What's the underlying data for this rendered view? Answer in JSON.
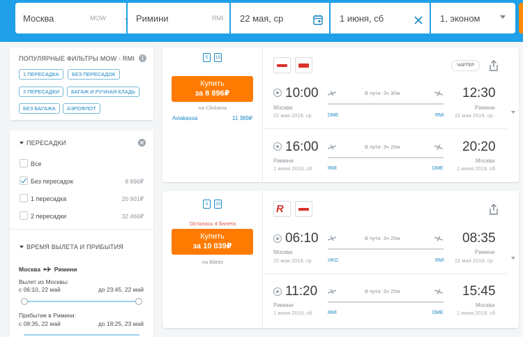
{
  "search": {
    "from": "Москва",
    "from_code": "MOW",
    "to": "Римини",
    "to_code": "RMI",
    "depart": "22 мая, ср",
    "return": "1 июня, сб",
    "passengers": "1, эконом"
  },
  "popular": {
    "title": "ПОПУЛЯРНЫЕ ФИЛЬТРЫ MOW - RMI",
    "chips": [
      "1 ПЕРЕСАДКА",
      "БЕЗ ПЕРЕСАДОК",
      "2 ПЕРЕСАДКИ",
      "БАГАЖ И РУЧНАЯ КЛАДЬ",
      "БЕЗ БАГАЖА",
      "АЭРОФЛОТ"
    ]
  },
  "stops": {
    "title": "ПЕРЕСАДКИ",
    "options": [
      {
        "label": "Все",
        "price": ""
      },
      {
        "label": "Без пересадок",
        "price": "8 896₽"
      },
      {
        "label": "1 пересадка",
        "price": "20 901₽"
      },
      {
        "label": "2 пересадки",
        "price": "32 466₽"
      }
    ]
  },
  "times": {
    "title": "ВРЕМЯ ВЫЛЕТА И ПРИБЫТИЯ",
    "route_from": "Москва",
    "route_to": "Римини",
    "departure_label": "Вылет из Москвы:",
    "departure_from": "с 06:10, 22 май",
    "departure_to": "до 23:45, 22 май",
    "arrival_label": "Прибытие в Римини:",
    "arrival_from": "с 08:35, 22 май",
    "arrival_to": "до 18:25, 23 май"
  },
  "results": [
    {
      "bag_a": "5",
      "bag_b": "15",
      "buy_label": "Купить",
      "price": "за 8 896₽",
      "seats_left": "",
      "agency": "на Clickavia",
      "alt_agency": "Aviakassa",
      "alt_price": "11 389₽",
      "badge": "ЧАРТЕР",
      "legs": [
        {
          "dep_time": "10:00",
          "arr_time": "12:30",
          "dep_city": "Москва",
          "arr_city": "Римини",
          "dep_date": "22 мая 2019, ср",
          "arr_date": "22 мая 2019, ср",
          "duration": "В пути: 3ч 30м",
          "dep_code": "DME",
          "arr_code": "RMI"
        },
        {
          "dep_time": "16:00",
          "arr_time": "20:20",
          "dep_city": "Римини",
          "arr_city": "Москва",
          "dep_date": "1 июня 2019, сб",
          "arr_date": "1 июня 2019, сб",
          "duration": "В пути: 3ч 20м",
          "dep_code": "RMI",
          "arr_code": "DME"
        }
      ]
    },
    {
      "bag_a": "5",
      "bag_b": "20",
      "buy_label": "Купить",
      "price": "за 10 039₽",
      "seats_left": "Осталось 4 билета",
      "agency": "на Biletix",
      "alt_agency": "",
      "alt_price": "",
      "badge": "",
      "legs": [
        {
          "dep_time": "06:10",
          "arr_time": "08:35",
          "dep_city": "Москва",
          "arr_city": "Римини",
          "dep_date": "22 мая 2019, ср",
          "arr_date": "22 мая 2019, ср",
          "duration": "В пути: 3ч 25м",
          "dep_code": "VKO",
          "arr_code": "RMI"
        },
        {
          "dep_time": "11:20",
          "arr_time": "15:45",
          "dep_city": "Римини",
          "arr_city": "Москва",
          "dep_date": "1 июня 2019, сб",
          "arr_date": "1 июня 2019, сб",
          "duration": "В пути: 3ч 25м",
          "dep_code": "RMI",
          "arr_code": "DME"
        }
      ]
    }
  ]
}
